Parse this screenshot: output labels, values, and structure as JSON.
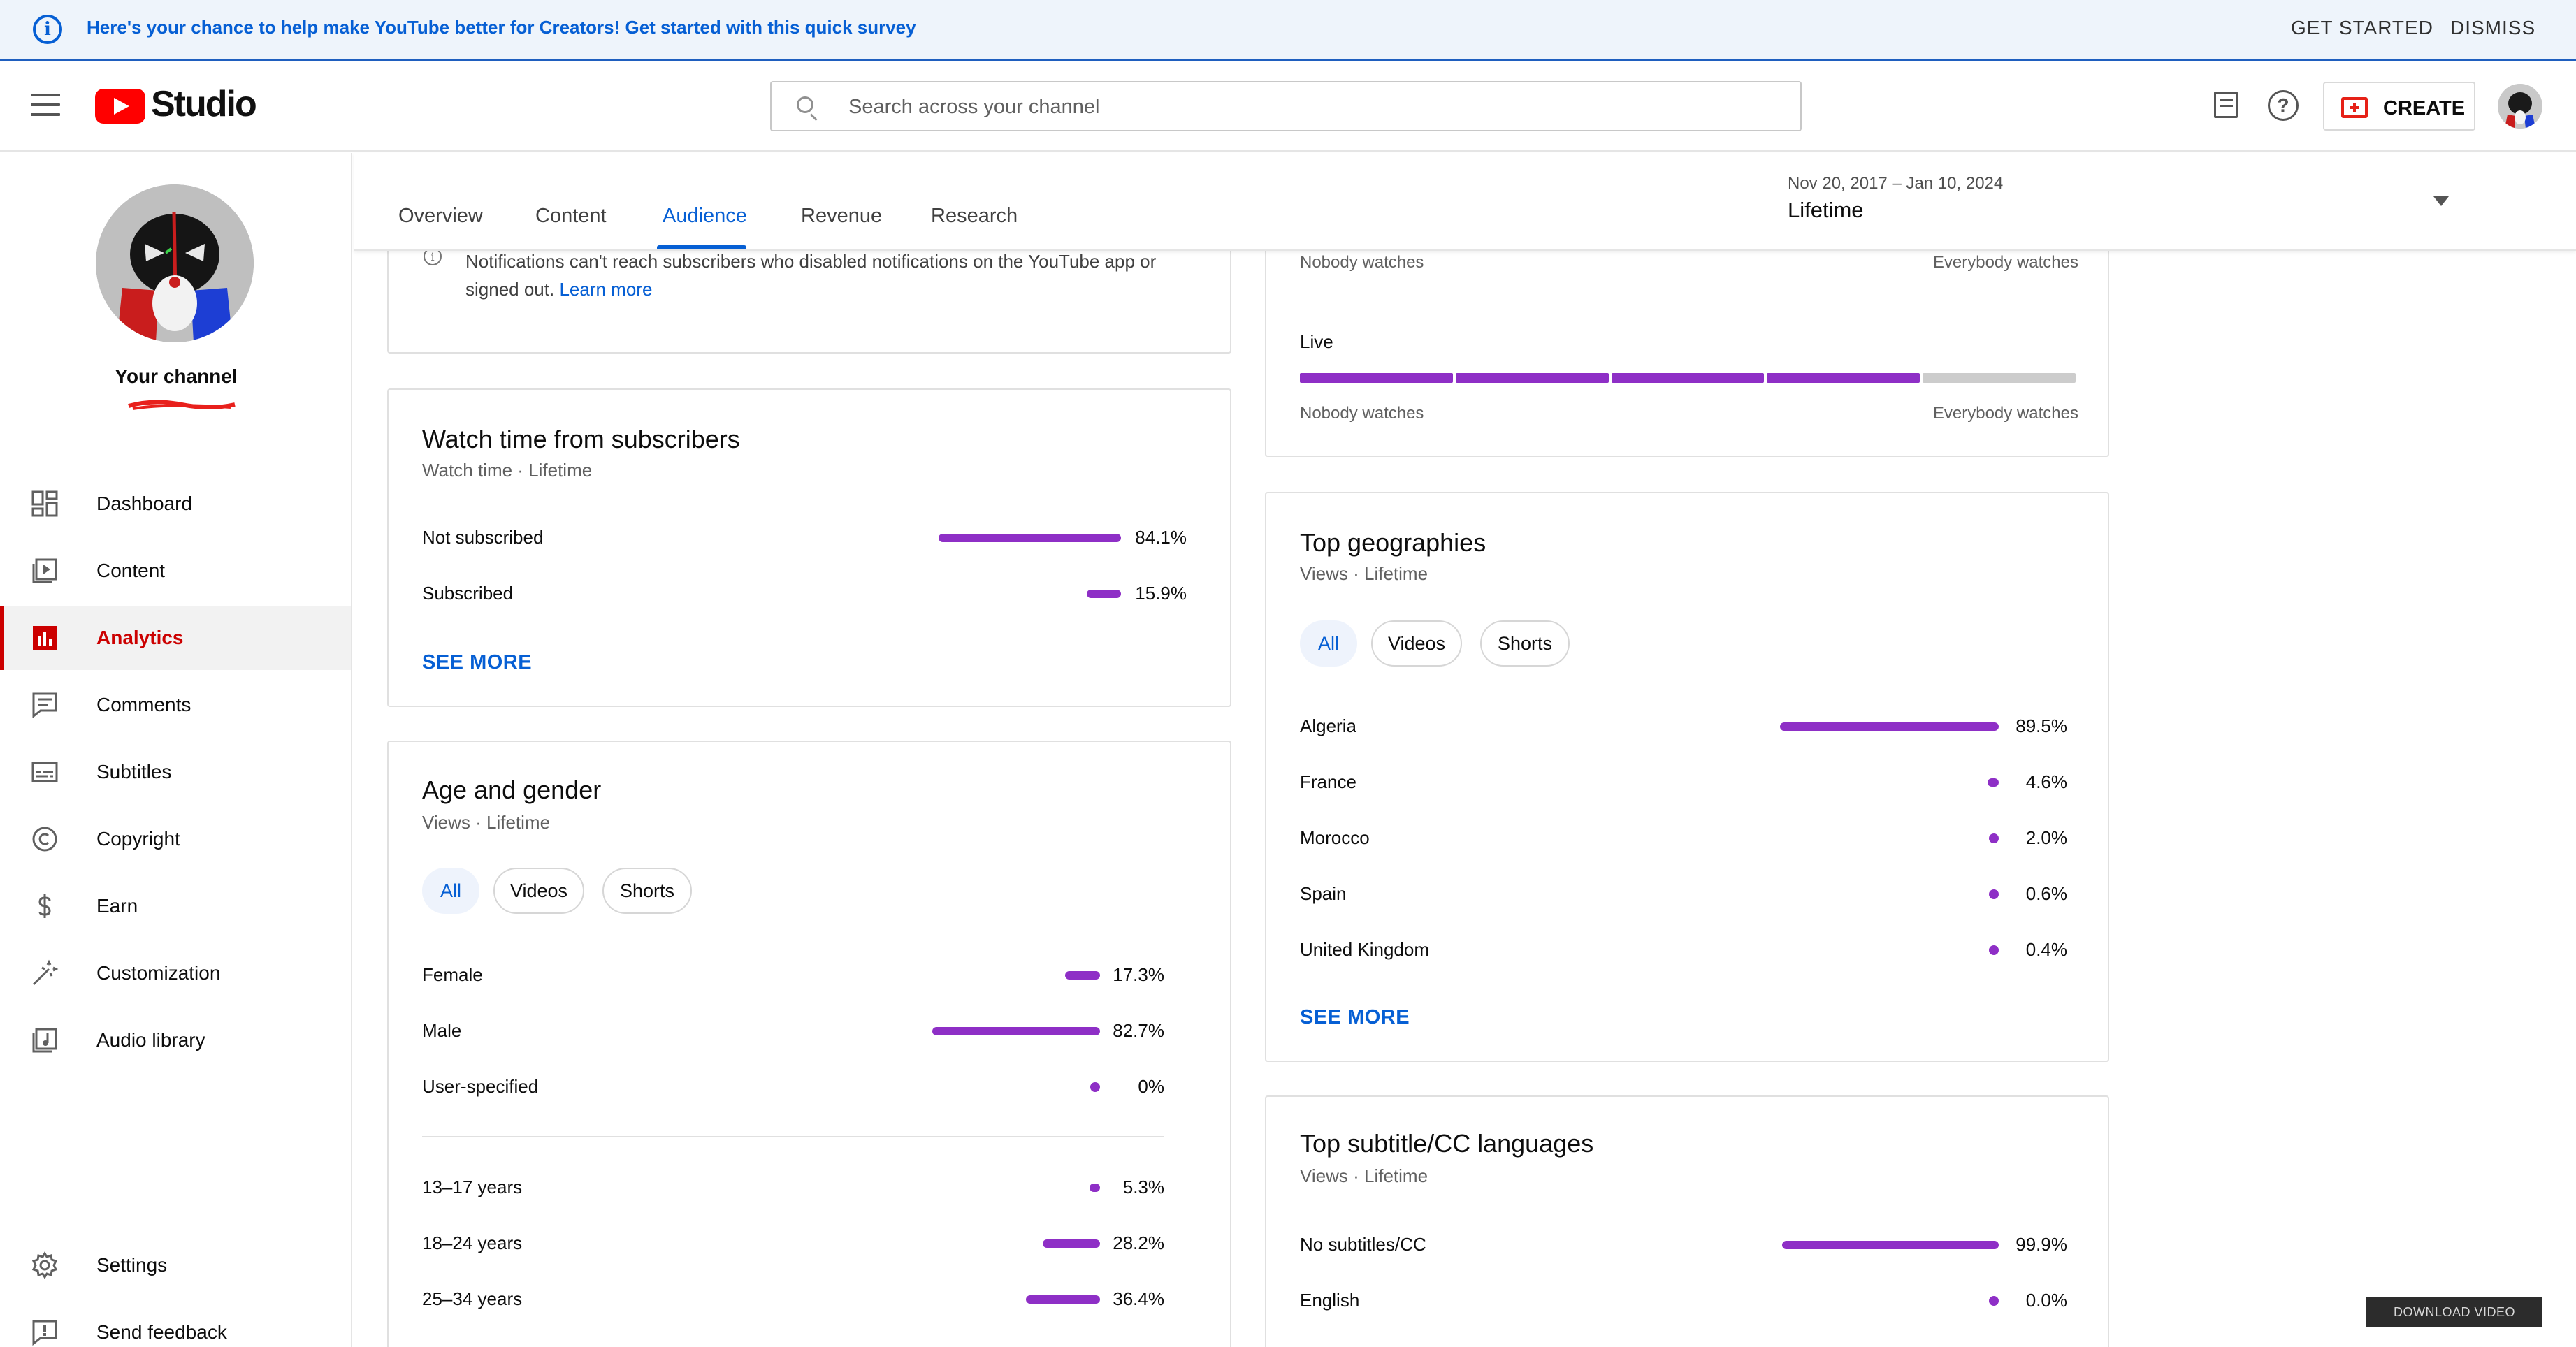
{
  "banner": {
    "text": "Here's your chance to help make YouTube better for Creators! Get started with this quick survey",
    "get_started": "GET STARTED",
    "dismiss": "DISMISS"
  },
  "header": {
    "logo_text": "Studio",
    "search_placeholder": "Search across your channel",
    "create_label": "CREATE"
  },
  "sidebar": {
    "channel_label": "Your channel",
    "items": [
      {
        "label": "Dashboard",
        "icon": "dashboard-icon"
      },
      {
        "label": "Content",
        "icon": "content-icon"
      },
      {
        "label": "Analytics",
        "icon": "analytics-icon",
        "active": true
      },
      {
        "label": "Comments",
        "icon": "comments-icon"
      },
      {
        "label": "Subtitles",
        "icon": "subtitles-icon"
      },
      {
        "label": "Copyright",
        "icon": "copyright-icon"
      },
      {
        "label": "Earn",
        "icon": "earn-icon"
      },
      {
        "label": "Customization",
        "icon": "customization-icon"
      },
      {
        "label": "Audio library",
        "icon": "audio-library-icon"
      }
    ],
    "bottom_items": [
      {
        "label": "Settings",
        "icon": "settings-icon"
      },
      {
        "label": "Send feedback",
        "icon": "feedback-icon"
      }
    ]
  },
  "tabs": {
    "items": [
      "Overview",
      "Content",
      "Audience",
      "Revenue",
      "Research"
    ],
    "active": "Audience",
    "date_range": "Nov 20, 2017 – Jan 10, 2024",
    "date_value": "Lifetime"
  },
  "notif_card": {
    "text": "Notifications can't reach subscribers who disabled notifications on the YouTube app or signed out.",
    "link": "Learn more"
  },
  "watch_time": {
    "title": "Watch time from subscribers",
    "subtitle": "Watch time · Lifetime",
    "rows": [
      {
        "label": "Not subscribed",
        "pct": "84.1%",
        "value": 84.1
      },
      {
        "label": "Subscribed",
        "pct": "15.9%",
        "value": 15.9
      }
    ],
    "see_more": "SEE MORE"
  },
  "age_gender": {
    "title": "Age and gender",
    "subtitle": "Views · Lifetime",
    "chips": [
      "All",
      "Videos",
      "Shorts"
    ],
    "gender_rows": [
      {
        "label": "Female",
        "pct": "17.3%",
        "value": 17.3
      },
      {
        "label": "Male",
        "pct": "82.7%",
        "value": 82.7
      },
      {
        "label": "User-specified",
        "pct": "0%",
        "value": 0
      }
    ],
    "age_rows": [
      {
        "label": "13–17 years",
        "pct": "5.3%",
        "value": 5.3
      },
      {
        "label": "18–24 years",
        "pct": "28.2%",
        "value": 28.2
      },
      {
        "label": "25–34 years",
        "pct": "36.4%",
        "value": 36.4
      }
    ]
  },
  "watch_scale": {
    "nobody": "Nobody watches",
    "everybody": "Everybody watches",
    "live_label": "Live",
    "live_filled_segments": 4,
    "total_segments": 5,
    "fill_color": "#8e2fc6",
    "empty_color": "#cccccc"
  },
  "geographies": {
    "title": "Top geographies",
    "subtitle": "Views · Lifetime",
    "chips": [
      "All",
      "Videos",
      "Shorts"
    ],
    "rows": [
      {
        "label": "Algeria",
        "pct": "89.5%",
        "value": 89.5
      },
      {
        "label": "France",
        "pct": "4.6%",
        "value": 4.6
      },
      {
        "label": "Morocco",
        "pct": "2.0%",
        "value": 2.0
      },
      {
        "label": "Spain",
        "pct": "0.6%",
        "value": 0.6
      },
      {
        "label": "United Kingdom",
        "pct": "0.4%",
        "value": 0.4
      }
    ],
    "see_more": "SEE MORE"
  },
  "subtitle_langs": {
    "title": "Top subtitle/CC languages",
    "subtitle": "Views · Lifetime",
    "rows": [
      {
        "label": "No subtitles/CC",
        "pct": "99.9%",
        "value": 99.9
      },
      {
        "label": "English",
        "pct": "0.0%",
        "value": 0.0
      }
    ]
  },
  "download_label": "DOWNLOAD VIDEO",
  "colors": {
    "accent_blue": "#065fd4",
    "bar_purple": "#8e2fc6",
    "brand_red": "#ff0000"
  }
}
